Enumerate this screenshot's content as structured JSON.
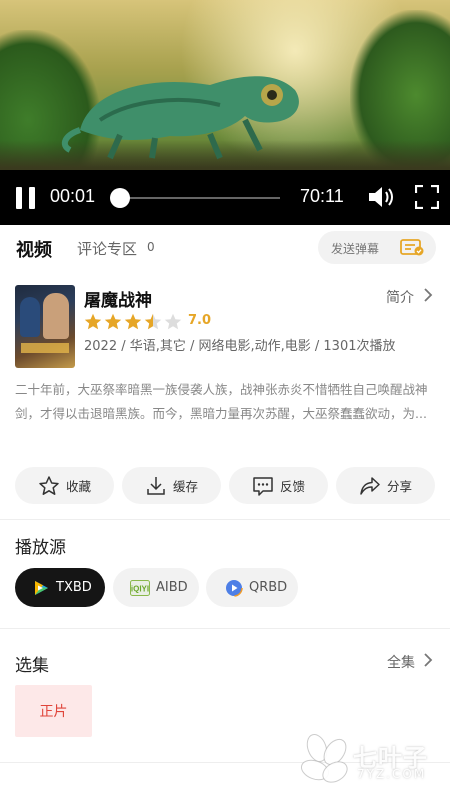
{
  "player": {
    "current_time": "00:01",
    "duration": "70:11",
    "progress": 0.0,
    "state": "playing"
  },
  "tabs": {
    "video": "视频",
    "comments": "评论专区",
    "comment_count": "0",
    "send_danmaku": "发送弹幕"
  },
  "movie": {
    "title": "屠魔战神",
    "intro_link": "简介",
    "rating": "7.0",
    "stars": 3.5,
    "meta": "2022 / 华语,其它 / 网络电影,动作,电影 / 1301次播放",
    "description": "二十年前，大巫祭率暗黑一族侵袭人族，战神张赤炎不惜牺牲自己唤醒战神剑，才得以击退暗黑族。而今，黑暗力量再次苏醒，大巫祭蠢蠢欲动，为..."
  },
  "actions": [
    {
      "label": "收藏",
      "icon": "star-outline-icon"
    },
    {
      "label": "缓存",
      "icon": "download-icon"
    },
    {
      "label": "反馈",
      "icon": "feedback-icon"
    },
    {
      "label": "分享",
      "icon": "share-icon"
    }
  ],
  "sources": {
    "title": "播放源",
    "items": [
      {
        "label": "TXBD",
        "icon": "tencent-video-icon",
        "active": true
      },
      {
        "label": "AIBD",
        "icon": "iqiyi-icon",
        "active": false
      },
      {
        "label": "QRBD",
        "icon": "qq-player-icon",
        "active": false
      }
    ]
  },
  "episodes": {
    "title": "选集",
    "all_link": "全集",
    "items": [
      "正片"
    ]
  },
  "watermark": {
    "text": "七叶子",
    "sub": "7YZ.COM"
  },
  "colors": {
    "accent_rating": "#e6a627",
    "episode_text": "#e0443a",
    "episode_bg": "#fde8e8",
    "active_source_bg": "#151515"
  }
}
